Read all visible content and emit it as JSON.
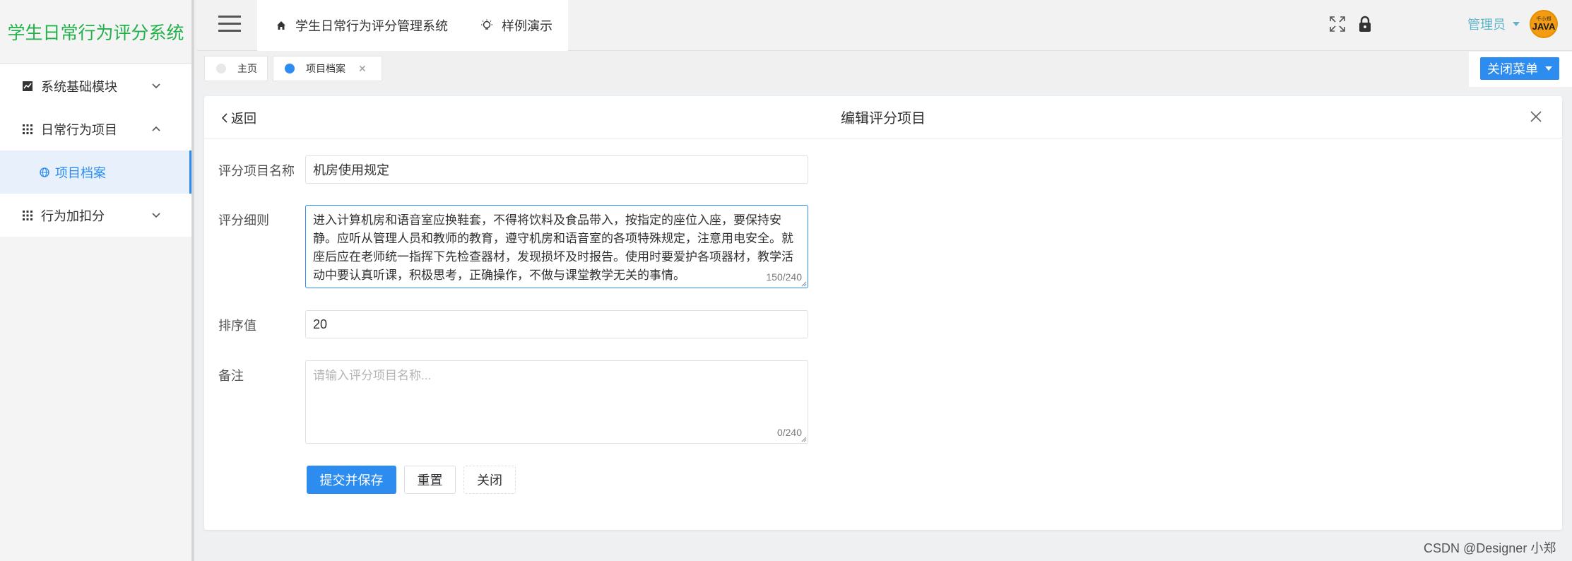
{
  "app": {
    "title": "学生日常行为评分系统"
  },
  "sidebar": {
    "items": [
      {
        "label": "系统基础模块",
        "icon": "chart-icon",
        "expanded": false
      },
      {
        "label": "日常行为项目",
        "icon": "grid-icon",
        "expanded": true,
        "children": [
          {
            "label": "项目档案",
            "icon": "globe-icon",
            "active": true
          }
        ]
      },
      {
        "label": "行为加扣分",
        "icon": "grid-icon",
        "expanded": false
      }
    ]
  },
  "topbar": {
    "nav": [
      {
        "label": "学生日常行为评分管理系统",
        "icon": "home-icon"
      },
      {
        "label": "样例演示",
        "icon": "bulb-icon"
      }
    ],
    "user": "管理员",
    "avatar_text": "JAVA",
    "avatar_sub": "千小郑"
  },
  "tabs": [
    {
      "label": "主页",
      "active": false
    },
    {
      "label": "项目档案",
      "active": true
    }
  ],
  "close_menu_label": "关闭菜单",
  "panel": {
    "back_label": "返回",
    "title": "编辑评分项目"
  },
  "form": {
    "name_label": "评分项目名称",
    "name_value": "机房使用规定",
    "detail_label": "评分细则",
    "detail_value": "进入计算机房和语音室应换鞋套，不得将饮料及食品带入，按指定的座位入座，要保持安静。应听从管理人员和教师的教育，遵守机房和语音室的各项特殊规定，注意用电安全。就座后应在老师统一指挥下先检查器材，发现损坏及时报告。使用时要爱护各项器材，教学活动中要认真听课，积极思考，正确操作，不做与课堂教学无关的事情。",
    "detail_count": "150/240",
    "sort_label": "排序值",
    "sort_value": "20",
    "remark_label": "备注",
    "remark_placeholder": "请输入评分项目名称...",
    "remark_count": "0/240"
  },
  "buttons": {
    "submit": "提交并保存",
    "reset": "重置",
    "close": "关闭"
  },
  "watermark": "CSDN @Designer 小郑",
  "colors": {
    "primary": "#2d8cf0",
    "logo": "#22b04a",
    "user": "#5fb6c9"
  }
}
